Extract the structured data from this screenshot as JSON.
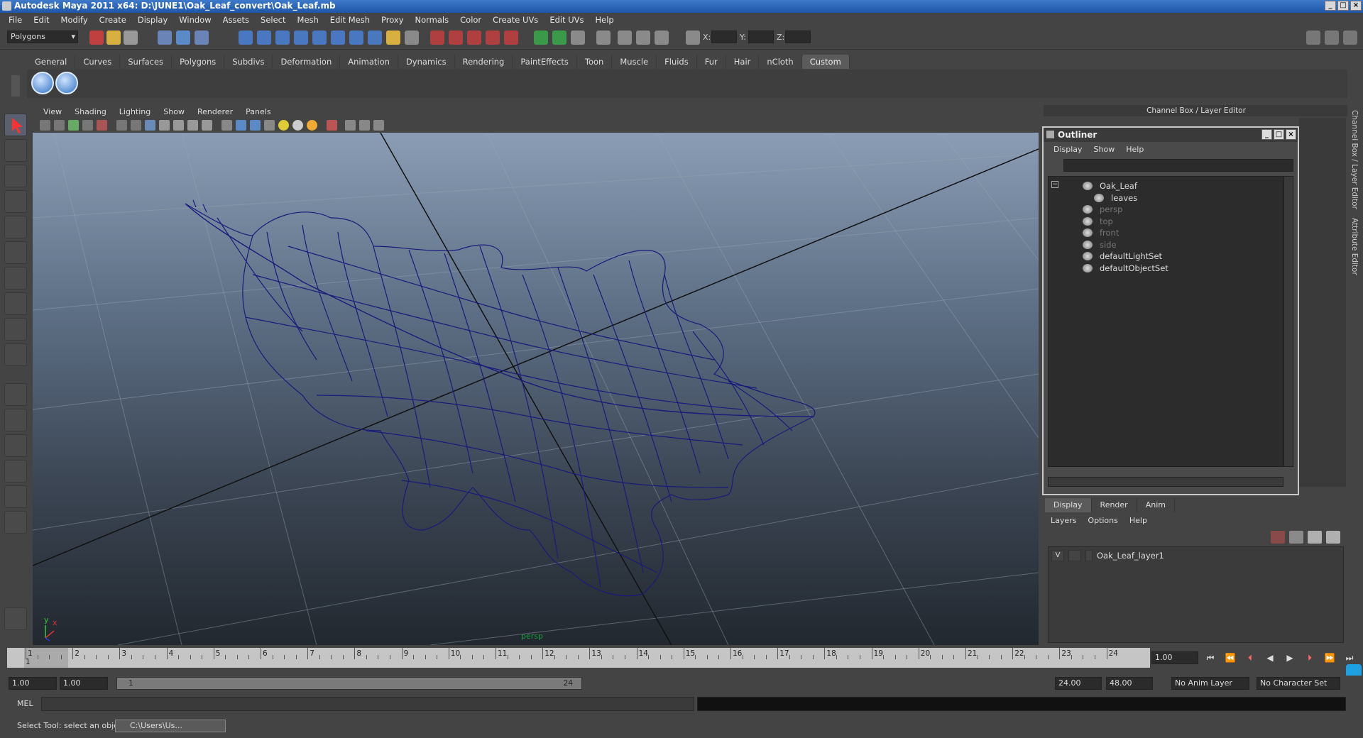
{
  "window": {
    "title": "Autodesk Maya 2011 x64: D:\\JUNE1\\Oak_Leaf_convert\\Oak_Leaf.mb"
  },
  "menubar": [
    "File",
    "Edit",
    "Modify",
    "Create",
    "Display",
    "Window",
    "Assets",
    "Select",
    "Mesh",
    "Edit Mesh",
    "Proxy",
    "Normals",
    "Color",
    "Create UVs",
    "Edit UVs",
    "Help"
  ],
  "statusline": {
    "menuset": "Polygons",
    "x_label": "X:",
    "y_label": "Y:",
    "z_label": "Z:"
  },
  "shelf": {
    "tabs": [
      "General",
      "Curves",
      "Surfaces",
      "Polygons",
      "Subdivs",
      "Deformation",
      "Animation",
      "Dynamics",
      "Rendering",
      "PaintEffects",
      "Toon",
      "Muscle",
      "Fluids",
      "Fur",
      "Hair",
      "nCloth",
      "Custom"
    ],
    "active": "Custom"
  },
  "viewport": {
    "menu": [
      "View",
      "Shading",
      "Lighting",
      "Show",
      "Renderer",
      "Panels"
    ],
    "camera_label": "persp",
    "axis_y": "y",
    "axis_x": "x"
  },
  "channelbox": {
    "header": "Channel Box / Layer Editor",
    "side_tab_1": "Channel Box / Layer Editor",
    "side_tab_2": "Attribute Editor"
  },
  "outliner": {
    "title": "Outliner",
    "menu": [
      "Display",
      "Show",
      "Help"
    ],
    "items": [
      {
        "label": "Oak_Leaf",
        "dim": false
      },
      {
        "label": "leaves",
        "dim": false
      },
      {
        "label": "persp",
        "dim": true
      },
      {
        "label": "top",
        "dim": true
      },
      {
        "label": "front",
        "dim": true
      },
      {
        "label": "side",
        "dim": true
      },
      {
        "label": "defaultLightSet",
        "dim": false
      },
      {
        "label": "defaultObjectSet",
        "dim": false
      }
    ]
  },
  "layer_editor": {
    "tabs": [
      "Display",
      "Render",
      "Anim"
    ],
    "active": "Display",
    "menu": [
      "Layers",
      "Options",
      "Help"
    ],
    "layer": {
      "visible": "V",
      "name": "Oak_Leaf_layer1"
    }
  },
  "timeline": {
    "ticks": [
      "1",
      "2",
      "3",
      "4",
      "5",
      "6",
      "7",
      "8",
      "9",
      "10",
      "11",
      "12",
      "13",
      "14",
      "15",
      "16",
      "17",
      "18",
      "19",
      "20",
      "21",
      "22",
      "23",
      "24"
    ],
    "current_frame_marker": "1",
    "current_frame": "1.00"
  },
  "range": {
    "start": "1.00",
    "playback_start": "1.00",
    "slider_start": "1",
    "slider_end": "24",
    "playback_end": "24.00",
    "end": "48.00",
    "anim_layer": "No Anim Layer",
    "character_set": "No Character Set"
  },
  "commandline": {
    "label": "MEL"
  },
  "helpline": {
    "text": "Select Tool: select an object",
    "task_item": "C:\\Users\\Us..."
  }
}
